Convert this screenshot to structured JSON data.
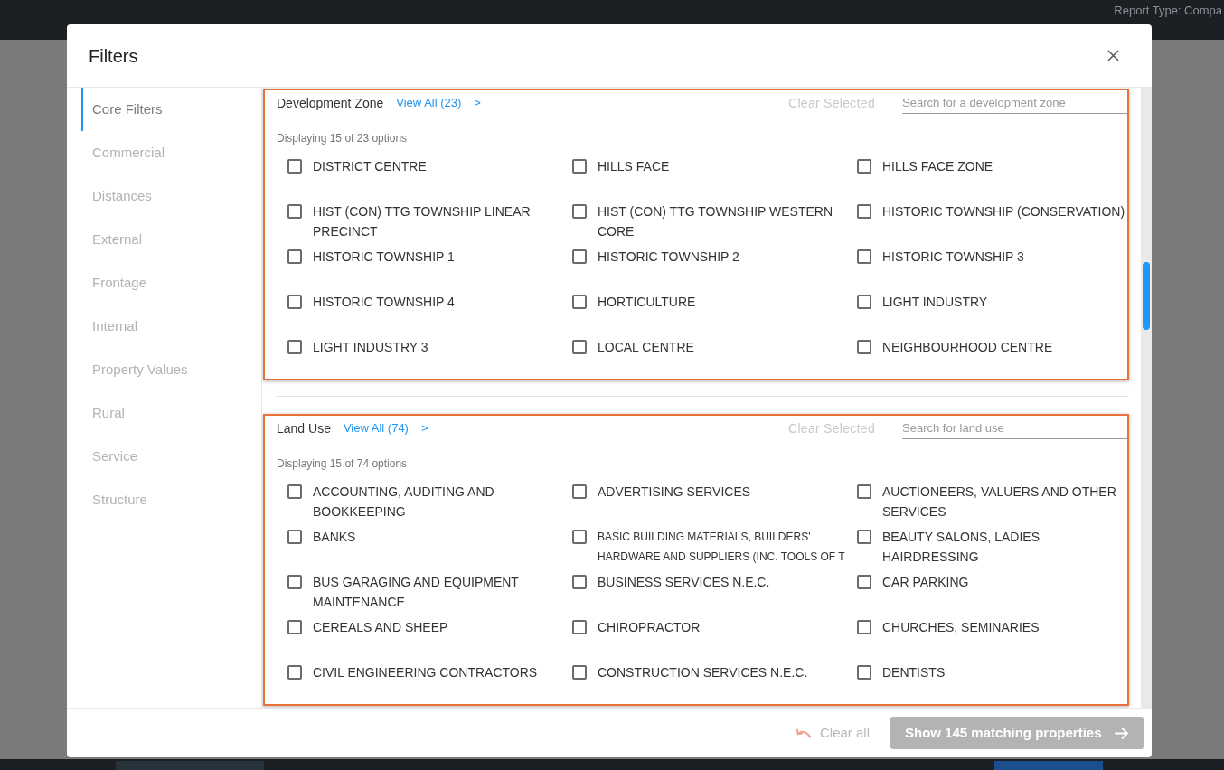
{
  "background": {
    "report_type": "Report Type: Compa"
  },
  "dialog": {
    "title": "Filters",
    "sidebar": {
      "items": [
        {
          "label": "Core Filters",
          "selected": true
        },
        {
          "label": "Commercial",
          "selected": false
        },
        {
          "label": "Distances",
          "selected": false
        },
        {
          "label": "External",
          "selected": false
        },
        {
          "label": "Frontage",
          "selected": false
        },
        {
          "label": "Internal",
          "selected": false
        },
        {
          "label": "Property Values",
          "selected": false
        },
        {
          "label": "Rural",
          "selected": false
        },
        {
          "label": "Service",
          "selected": false
        },
        {
          "label": "Structure",
          "selected": false
        }
      ]
    },
    "sections": [
      {
        "title": "Development Zone",
        "view_all": "View All (23)",
        "arrow": ">",
        "clear": {
          "label": "Clear Selected",
          "disabled": true
        },
        "search": {
          "placeholder": "Search for a development zone"
        },
        "summary": "Displaying 15 of 23 options",
        "options": [
          {
            "label": "DISTRICT CENTRE",
            "checked": false
          },
          {
            "label": "HILLS FACE",
            "checked": false
          },
          {
            "label": "HILLS FACE ZONE",
            "checked": false
          },
          {
            "label": "HIST (CON) TTG TOWNSHIP LINEAR PRECINCT",
            "checked": false
          },
          {
            "label": "HIST (CON) TTG TOWNSHIP WESTERN CORE",
            "checked": false
          },
          {
            "label": "HISTORIC TOWNSHIP (CONSERVATION)",
            "checked": false
          },
          {
            "label": "HISTORIC TOWNSHIP 1",
            "checked": false
          },
          {
            "label": "HISTORIC TOWNSHIP 2",
            "checked": false
          },
          {
            "label": "HISTORIC TOWNSHIP 3",
            "checked": false
          },
          {
            "label": "HISTORIC TOWNSHIP 4",
            "checked": false
          },
          {
            "label": "HORTICULTURE",
            "checked": false
          },
          {
            "label": "LIGHT INDUSTRY",
            "checked": false
          },
          {
            "label": "LIGHT INDUSTRY 3",
            "checked": false
          },
          {
            "label": "LOCAL CENTRE",
            "checked": false
          },
          {
            "label": "NEIGHBOURHOOD CENTRE",
            "checked": false
          }
        ]
      },
      {
        "title": "Land Use",
        "view_all": "View All (74)",
        "arrow": ">",
        "clear": {
          "label": "Clear Selected",
          "disabled": true
        },
        "search": {
          "placeholder": "Search for land use"
        },
        "summary": "Displaying 15 of 74 options",
        "options": [
          {
            "label": "ACCOUNTING, AUDITING AND BOOKKEEPING",
            "checked": false,
            "kind": "regular"
          },
          {
            "label": "ADVERTISING SERVICES",
            "checked": false,
            "kind": "regular"
          },
          {
            "label": "AUCTIONEERS, VALUERS AND OTHER SERVICES",
            "checked": false,
            "kind": "regular"
          },
          {
            "label": "BANKS",
            "checked": false,
            "kind": "regular"
          },
          {
            "label": "BASIC BUILDING MATERIALS, BUILDERS' HARDWARE AND SUPPLIERS (INC. TOOLS OF T",
            "checked": false,
            "kind": "compact"
          },
          {
            "label": "BEAUTY SALONS, LADIES HAIRDRESSING",
            "checked": false,
            "kind": "regular"
          },
          {
            "label": "BUS GARAGING AND EQUIPMENT MAINTENANCE",
            "checked": false,
            "kind": "regular"
          },
          {
            "label": "BUSINESS SERVICES N.E.C.",
            "checked": false,
            "kind": "regular"
          },
          {
            "label": "CAR PARKING",
            "checked": false,
            "kind": "regular"
          },
          {
            "label": "CEREALS AND SHEEP",
            "checked": false,
            "kind": "regular"
          },
          {
            "label": "CHIROPRACTOR",
            "checked": false,
            "kind": "regular"
          },
          {
            "label": "CHURCHES, SEMINARIES",
            "checked": false,
            "kind": "regular"
          },
          {
            "label": "CIVIL ENGINEERING CONTRACTORS",
            "checked": false,
            "kind": "regular"
          },
          {
            "label": "CONSTRUCTION SERVICES N.E.C.",
            "checked": false,
            "kind": "regular"
          },
          {
            "label": "DENTISTS",
            "checked": false,
            "kind": "regular"
          }
        ]
      }
    ],
    "footer": {
      "clear_all": {
        "label": "Clear all",
        "disabled": true
      },
      "show_button": {
        "label": "Show 145 matching properties",
        "disabled": true
      }
    }
  }
}
